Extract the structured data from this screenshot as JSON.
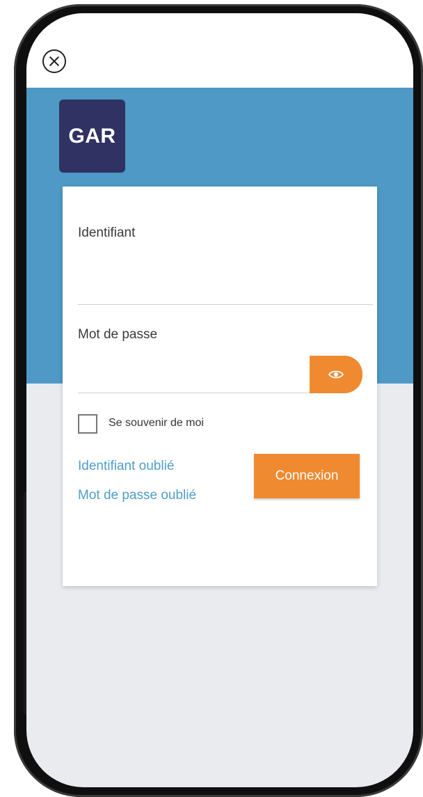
{
  "logo": {
    "text": "GAR"
  },
  "form": {
    "identifier_label": "Identifiant",
    "identifier_value": "",
    "password_label": "Mot de passe",
    "password_value": "",
    "remember_label": "Se souvenir de moi",
    "remember_checked": false,
    "forgot_identifier": "Identifiant oublié",
    "forgot_password": "Mot de passe oublié",
    "submit_label": "Connexion"
  },
  "icons": {
    "close": "close-circle-icon",
    "show_password": "eye-icon"
  },
  "colors": {
    "header_blue": "#4e99c5",
    "logo_bg": "#303263",
    "accent_orange": "#ef8a30",
    "link_blue": "#4e9ec9",
    "page_bg": "#eaebef"
  }
}
